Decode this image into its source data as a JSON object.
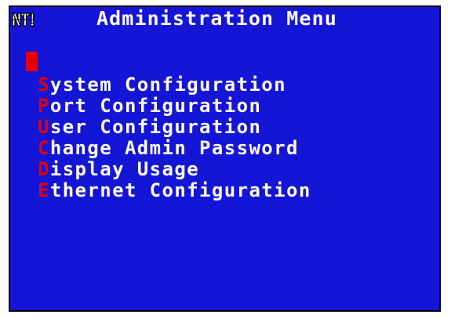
{
  "window": {
    "title": "Administration Menu",
    "logo_text": "NTI"
  },
  "colors": {
    "background": "#1515d6",
    "text": "#ffffff",
    "hotkey": "#e60000",
    "cursor": "#e60000"
  },
  "menu": {
    "items": [
      {
        "hotkey": "S",
        "rest": "ystem Configuration"
      },
      {
        "hotkey": "P",
        "rest": "ort Configuration"
      },
      {
        "hotkey": "U",
        "rest": "ser Configuration"
      },
      {
        "hotkey": "C",
        "rest": "hange Admin Password"
      },
      {
        "hotkey": "D",
        "rest": "isplay Usage"
      },
      {
        "hotkey": "E",
        "rest": "thernet Configuration"
      }
    ]
  }
}
